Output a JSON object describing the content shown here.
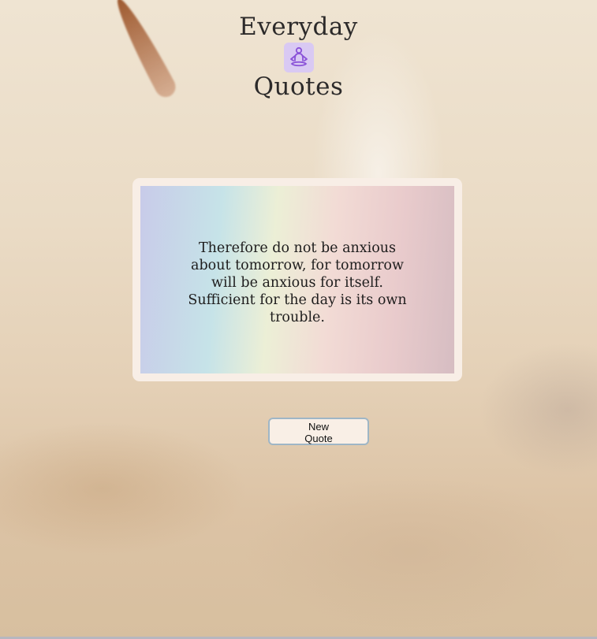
{
  "header": {
    "title_top": "Everyday",
    "title_bottom": "Quotes",
    "logo_icon": "meditation-icon"
  },
  "quote_card": {
    "text": "Therefore do not be anxious about tomorrow, for tomorrow will be anxious for itself. Sufficient for the day is its own trouble."
  },
  "actions": {
    "new_quote_label": "New Quote"
  },
  "colors": {
    "logo_bg": "#d9c9f3",
    "logo_figure": "#8a52d8",
    "card_frame": "#f8eee6",
    "button_border": "#9fb6c6"
  }
}
